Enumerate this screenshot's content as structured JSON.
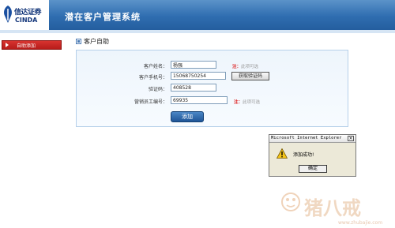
{
  "header": {
    "logo_cn": "信达证券",
    "logo_en": "CINDA",
    "system_title": "潜在客户管理系统",
    "background_color": "#2f6db0"
  },
  "sidebar": {
    "items": [
      {
        "label": "自助添加",
        "active": true,
        "color": "#c0211e"
      }
    ]
  },
  "main": {
    "section_title": "客户自助",
    "form": {
      "fields": [
        {
          "label": "客户姓名：",
          "value": "杨强",
          "required_text": "此项可选"
        },
        {
          "label": "客户手机号：",
          "value": "15068750254"
        },
        {
          "label": "验证码：",
          "value": "408528"
        },
        {
          "label": "营销员工编号：",
          "value": "69935",
          "required_text": "此项可选"
        }
      ],
      "get_code_button": "获取验证码",
      "submit_button": "添加",
      "required_mark": "注："
    }
  },
  "dialog": {
    "title": "Microsoft Internet Explorer",
    "message": "添加成功!",
    "ok_button": "确定",
    "close_glyph": "×",
    "icon": "warning-icon"
  },
  "watermark": {
    "text": "猪八戒",
    "url": "www.zhubajie.com"
  }
}
